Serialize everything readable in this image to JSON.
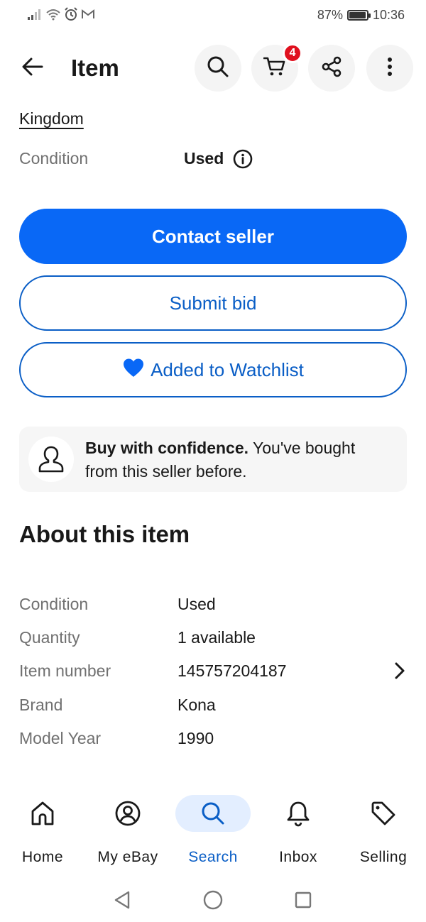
{
  "status_bar": {
    "battery_percent_label": "87%",
    "battery_level": 0.87,
    "time": "10:36",
    "icons": [
      "signal-icon",
      "wifi-icon",
      "alarm-icon",
      "gmail-icon"
    ]
  },
  "header": {
    "title": "Item",
    "cart_count": "4",
    "icons": [
      "back-arrow-icon",
      "search-icon",
      "cart-icon",
      "share-icon",
      "more-vertical-icon"
    ]
  },
  "seller_location_tail": "Kingdom",
  "condition": {
    "label": "Condition",
    "value": "Used"
  },
  "actions": {
    "contact_seller": "Contact seller",
    "submit_bid": "Submit bid",
    "watchlist": "Added to Watchlist"
  },
  "confidence": {
    "bold": "Buy with confidence.",
    "text": " You've bought from this seller before."
  },
  "about": {
    "title": "About this item",
    "specs": [
      {
        "label": "Condition",
        "value": "Used"
      },
      {
        "label": "Quantity",
        "value": "1 available"
      },
      {
        "label": "Item number",
        "value": "145757204187"
      },
      {
        "label": "Brand",
        "value": "Kona"
      },
      {
        "label": "Model Year",
        "value": "1990"
      }
    ]
  },
  "bottom_nav": {
    "items": [
      {
        "label": "Home",
        "icon": "home-icon"
      },
      {
        "label": "My eBay",
        "icon": "user-circle-icon"
      },
      {
        "label": "Search",
        "icon": "search-icon",
        "active": true
      },
      {
        "label": "Inbox",
        "icon": "bell-icon"
      },
      {
        "label": "Selling",
        "icon": "tag-icon"
      }
    ]
  },
  "colors": {
    "primary": "#0968f6",
    "outline_blue": "#0a5ec6",
    "badge_red": "#e0101e",
    "nav_active_bg": "#e3eeff"
  }
}
